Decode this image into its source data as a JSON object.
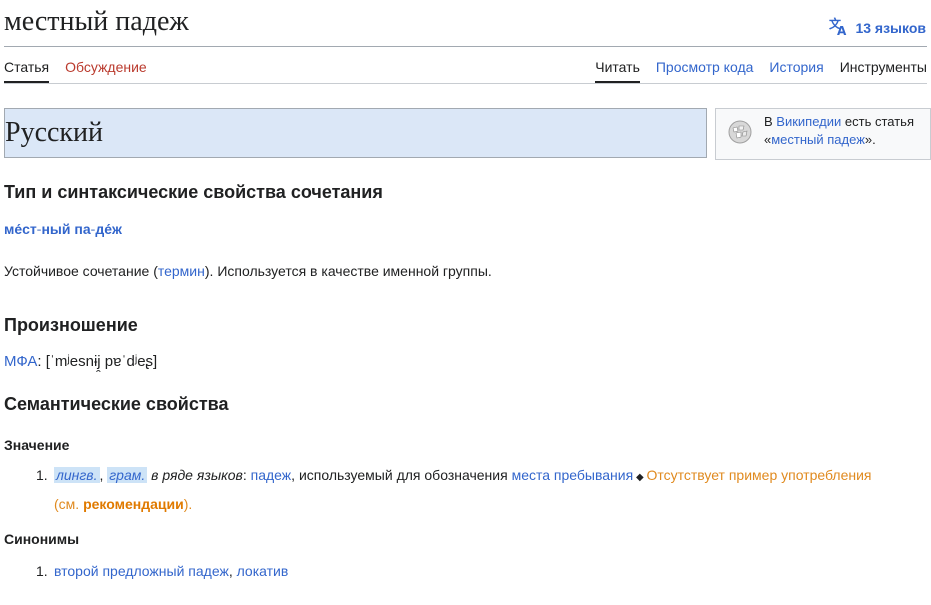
{
  "header": {
    "title": "местный падеж",
    "languages_label": "13 языков"
  },
  "tabs": {
    "left": [
      "Статья",
      "Обсуждение"
    ],
    "right": [
      "Читать",
      "Просмотр кода",
      "История",
      "Инструменты"
    ]
  },
  "language_section": {
    "heading": "Русский"
  },
  "sister": {
    "prefix": "В ",
    "wiki_link": "Википедии",
    "middle": " есть статья",
    "open_quote": "«",
    "article_link": "местный падеж",
    "close_quote": "»."
  },
  "section_type": {
    "heading": "Тип и синтаксические свойства сочетания",
    "hyphenation": [
      "ме́ст",
      "ный",
      "па",
      "де́ж"
    ],
    "desc_pre": "Устойчивое сочетание (",
    "desc_link": "термин",
    "desc_post": "). Используется в качестве именной группы."
  },
  "pronunciation": {
    "heading": "Произношение",
    "ipa_label": "МФА",
    "ipa_value": ": [ˈmʲesnɨj̯ pɐˈdʲeʂ]"
  },
  "semantics": {
    "heading": "Семантические свойства",
    "meaning_heading": "Значение",
    "meaning": {
      "num": "1.",
      "tag1": "лингв.",
      "comma1": ",",
      "tag2": "грам.",
      "context": " в ряде языков",
      "colon": ": ",
      "link1": "падеж",
      "mid": ", используемый для обозначения ",
      "link2": "места пребывания",
      "diamond": " ◆ ",
      "missing_pre": "Отсутствует пример употребления (см. ",
      "missing_link": "рекомендации",
      "missing_post": ")."
    },
    "synonyms_heading": "Синонимы",
    "synonyms": {
      "num": "1.",
      "syn1": "второй предложный падеж",
      "sep": ", ",
      "syn2": "локатив"
    }
  }
}
